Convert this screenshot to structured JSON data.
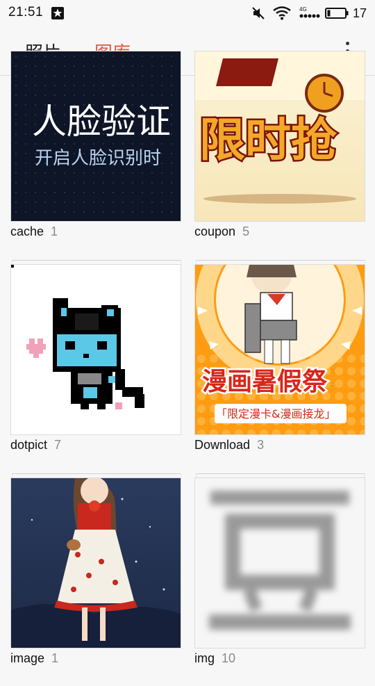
{
  "status_bar": {
    "time": "21:51",
    "battery_level": "17",
    "network_label": "4G",
    "icons": [
      "notification-icon",
      "mute-icon",
      "wifi-icon",
      "signal-icon",
      "battery-icon"
    ]
  },
  "tabs": {
    "photos_label": "照片",
    "gallery_label": "图库",
    "active": "gallery"
  },
  "accent_color": "#e0563e",
  "albums": [
    {
      "name": "cache",
      "count": "1",
      "thumb_text_1": "人脸验证",
      "thumb_text_2": "开启人脸识别时"
    },
    {
      "name": "coupon",
      "count": "5",
      "thumb_text_1": "限时抢"
    },
    {
      "name": "dotpict",
      "count": "7"
    },
    {
      "name": "Download",
      "count": "3",
      "thumb_text_1": "漫画暑假祭",
      "thumb_text_2": "「限定漫卡&漫画接龙」"
    },
    {
      "name": "image",
      "count": "1"
    },
    {
      "name": "img",
      "count": "10",
      "thumb_text_1": "豆"
    }
  ]
}
